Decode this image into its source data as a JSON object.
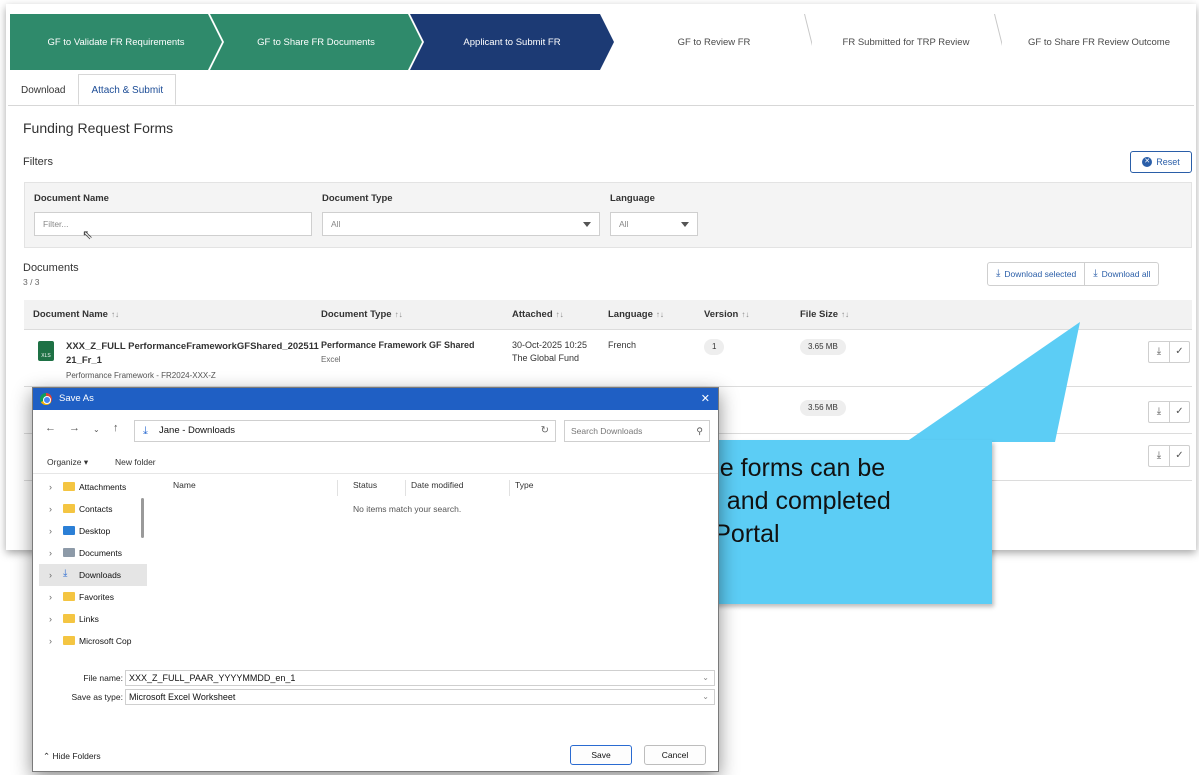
{
  "stepper": {
    "steps": [
      {
        "label": "GF to Validate FR Requirements",
        "state": "completed"
      },
      {
        "label": "GF to Share FR Documents",
        "state": "completed"
      },
      {
        "label": "Applicant to Submit FR",
        "state": "current"
      },
      {
        "label": "GF to Review FR",
        "state": "upcoming"
      },
      {
        "label": "FR Submitted for TRP Review",
        "state": "upcoming"
      },
      {
        "label": "GF to Share FR Review Outcome",
        "state": "upcoming"
      }
    ]
  },
  "tabs": [
    {
      "label": "Download",
      "active": false
    },
    {
      "label": "Attach & Submit",
      "active": true
    }
  ],
  "section_title": "Funding Request Forms",
  "filters": {
    "label": "Filters",
    "reset_label": "Reset",
    "document_name_label": "Document Name",
    "document_name_placeholder": "Filter...",
    "document_type_label": "Document Type",
    "document_type_value": "All",
    "language_label": "Language",
    "language_value": "All"
  },
  "documents": {
    "label": "Documents",
    "count": "3 / 3",
    "download_selected_label": "Download selected",
    "download_all_label": "Download all",
    "columns": [
      "Document Name",
      "Document Type",
      "Attached",
      "Language",
      "Version",
      "File Size"
    ],
    "sort_glyph": "↑↓",
    "rows": [
      {
        "name_line1": "XXX_Z_FULL PerformanceFrameworkGFShared_202511",
        "name_line2": "21_Fr_1",
        "subtitle": "Performance Framework - FR2024-XXX-Z",
        "type": "Performance Framework GF Shared",
        "type_sub": "Excel",
        "attached_date": "30-Oct-2025 10:25",
        "attached_by": "The Global Fund",
        "language": "French",
        "version": "1",
        "size": "3.65 MB"
      },
      {
        "size": "3.56 MB"
      }
    ],
    "file_icon_text": "XLS"
  },
  "dialog": {
    "title": "Save As",
    "address": "Jane - Downloads",
    "search_placeholder": "Search Downloads",
    "organize_label": "Organize ▾",
    "new_folder_label": "New folder",
    "folders": [
      {
        "label": "Attachments",
        "icon": "folder-icon",
        "color": "#f4c542"
      },
      {
        "label": "Contacts",
        "icon": "folder-icon",
        "color": "#f4c542"
      },
      {
        "label": "Desktop",
        "icon": "desktop-icon",
        "color": "#2b7fd6"
      },
      {
        "label": "Documents",
        "icon": "documents-icon",
        "color": "#8d9aa8"
      },
      {
        "label": "Downloads",
        "icon": "download-icon",
        "color": "#2a6bd1"
      },
      {
        "label": "Favorites",
        "icon": "folder-icon",
        "color": "#f4c542"
      },
      {
        "label": "Links",
        "icon": "folder-icon",
        "color": "#f4c542"
      },
      {
        "label": "Microsoft Cop",
        "icon": "folder-icon",
        "color": "#f4c542"
      }
    ],
    "list_columns": [
      "Name",
      "Status",
      "Date modified",
      "Type"
    ],
    "empty_message": "No items match your search.",
    "file_name_label": "File name:",
    "file_name_value": "XXX_Z_FULL_PAAR_YYYYMMDD_en_1",
    "save_type_label": "Save as type:",
    "save_type_value": "Microsoft Excel Worksheet",
    "hide_folders_label": "Hide Folders",
    "save_label": "Save",
    "cancel_label": "Cancel"
  },
  "callout": {
    "line1": "The available forms can be",
    "line2": "downloaded and completed",
    "line3": "outside the Portal"
  },
  "colors": {
    "completed_step": "#2f8a6b",
    "current_step": "#1c3a74",
    "accent_blue": "#2a5ea8",
    "callout": "#5ccdf5",
    "dialog_title": "#1f5fc4"
  }
}
